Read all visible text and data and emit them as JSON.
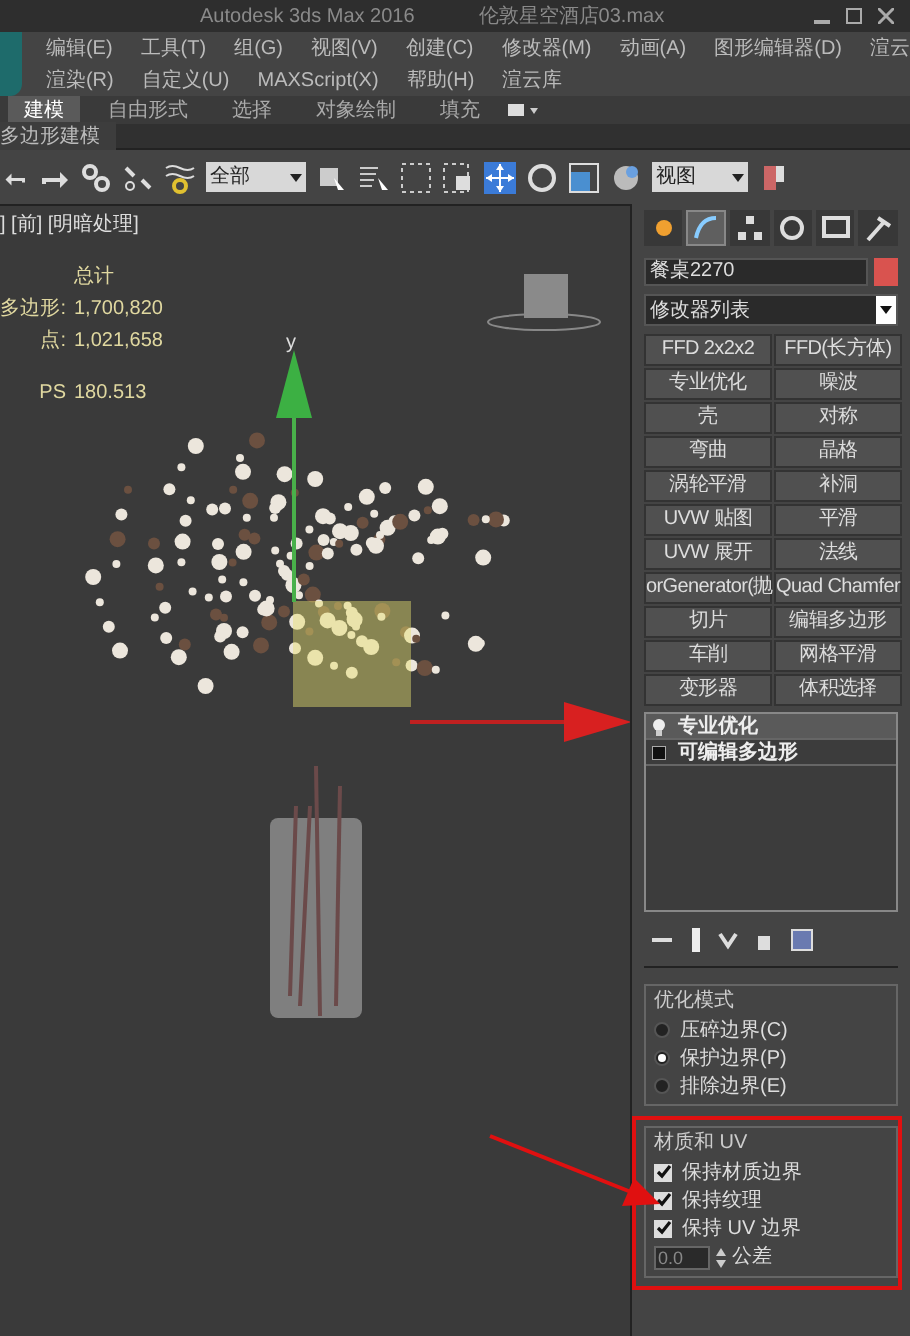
{
  "window": {
    "title": "Autodesk 3ds Max 2016",
    "file": "伦敦星空酒店03.max"
  },
  "menu_rows": [
    [
      "编辑(E)",
      "工具(T)",
      "组(G)",
      "视图(V)",
      "创建(C)",
      "修改器(M)",
      "动画(A)",
      "图形编辑器(D)",
      "渲云"
    ],
    [
      "渲染(R)",
      "自定义(U)",
      "MAXScript(X)",
      "帮助(H)",
      "渲云库"
    ]
  ],
  "ribbon_tabs": [
    {
      "label": "建模",
      "selected": true
    },
    {
      "label": "自由形式",
      "selected": false
    },
    {
      "label": "选择",
      "selected": false
    },
    {
      "label": "对象绘制",
      "selected": false
    },
    {
      "label": "填充",
      "selected": false
    }
  ],
  "ribbon_panel": {
    "label": "多边形建模"
  },
  "toolbar": {
    "selection_filter": "全部",
    "reference_coord": "视图"
  },
  "viewport": {
    "label": "] [前] [明暗处理]",
    "axis_label": "y",
    "stats": [
      {
        "value": "总计"
      },
      {
        "label": "多边形:",
        "value": "1,700,820"
      },
      {
        "label": "点:",
        "value": "1,021,658"
      },
      {
        "label": "PS",
        "value": "180.513"
      }
    ]
  },
  "command_panel": {
    "tabs": [
      {
        "selected": false
      },
      {
        "selected": true
      },
      {
        "selected": false
      },
      {
        "selected": false
      },
      {
        "selected": false
      },
      {
        "selected": false
      }
    ],
    "object_name": "餐桌2270",
    "modifier_list": "修改器列表",
    "modifier_buttons": [
      "FFD 2x2x2",
      "FFD(长方体)",
      "专业优化",
      "噪波",
      "壳",
      "对称",
      "弯曲",
      "晶格",
      "涡轮平滑",
      "补洞",
      "UVW 贴图",
      "平滑",
      "UVW 展开",
      "法线",
      "orGenerator(抛",
      "Quad Chamfer",
      "切片",
      "编辑多边形",
      "车削",
      "网格平滑",
      "变形器",
      "体积选择"
    ],
    "stack": [
      {
        "label": "专业优化",
        "selected": true
      },
      {
        "label": "可编辑多边形",
        "selected": false
      }
    ],
    "groups": [
      {
        "title": "优化模式",
        "options": [
          {
            "kind": "radio",
            "label": "压碎边界(C)",
            "selected": false
          },
          {
            "kind": "radio",
            "label": "保护边界(P)",
            "selected": true
          },
          {
            "kind": "radio",
            "label": "排除边界(E)",
            "selected": false
          }
        ]
      },
      {
        "title": "材质和 UV",
        "options": [
          {
            "kind": "checkbox",
            "label": "保持材质边界",
            "checked": true
          },
          {
            "kind": "checkbox",
            "label": "保持纹理",
            "checked": true
          },
          {
            "kind": "checkbox",
            "label": "保持 UV 边界",
            "checked": true
          }
        ]
      }
    ],
    "tolerance": {
      "value": "0.0",
      "label": "公差"
    }
  }
}
